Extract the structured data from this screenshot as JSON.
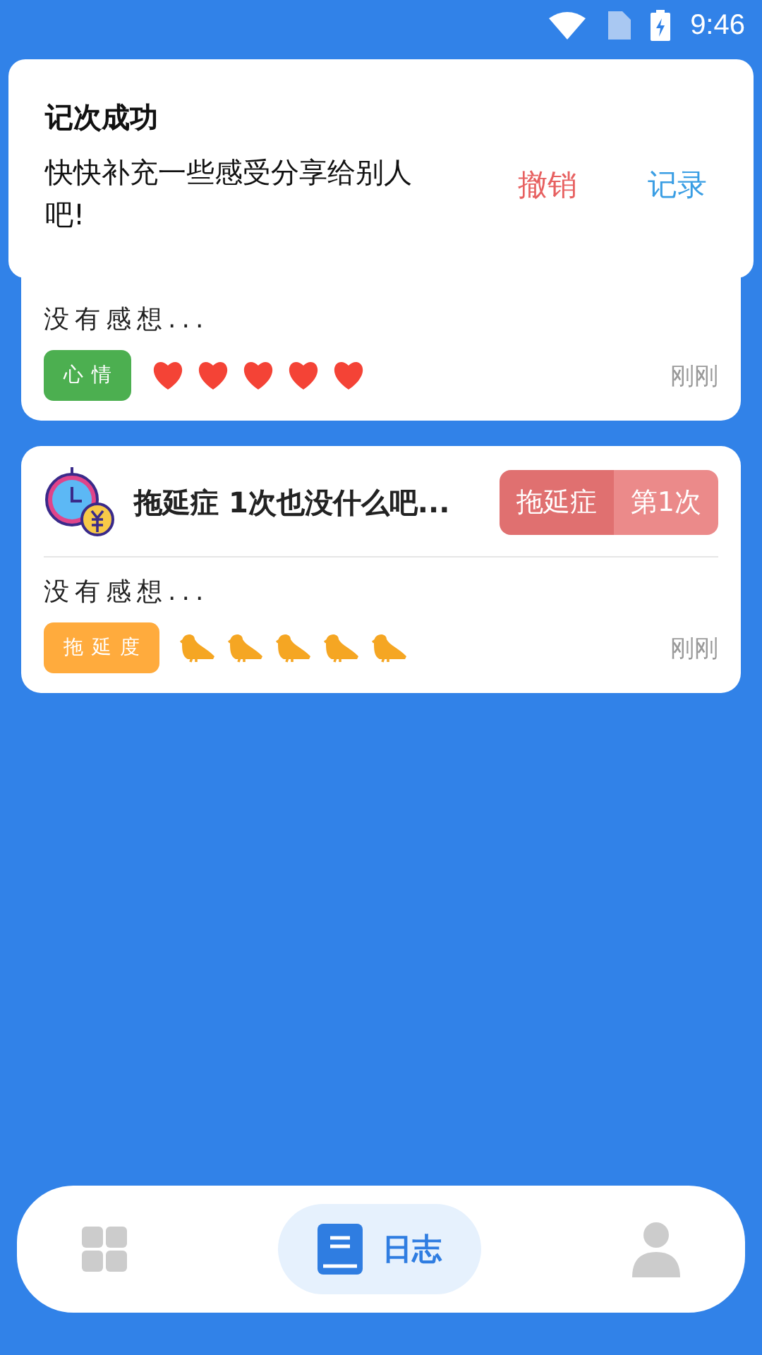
{
  "status_bar": {
    "time": "9:46"
  },
  "toast": {
    "title": "记次成功",
    "message": "快快补充一些感受分享给别人吧!",
    "actions": [
      {
        "label": "撤销",
        "kind": "cancel"
      },
      {
        "label": "记录",
        "kind": "confirm"
      }
    ]
  },
  "entries": [
    {
      "note": "没有感想...",
      "tag": {
        "label": "心情",
        "color": "#4caf50"
      },
      "kind": "heart",
      "stars": 5,
      "time": "刚刚"
    },
    {
      "title": "拖延症 1次也没什么吧...",
      "badge": [
        "拖延症",
        "第1次"
      ],
      "note": "没有感想...",
      "tag": {
        "label": "拖延度",
        "color": "#ffab3d"
      },
      "kind": "bird",
      "stars": 5,
      "time": "刚刚"
    }
  ],
  "nav": [
    {
      "kind": "grid",
      "selected": false
    },
    {
      "kind": "journal",
      "label": "日志",
      "selected": true
    },
    {
      "kind": "profile",
      "selected": false
    }
  ]
}
